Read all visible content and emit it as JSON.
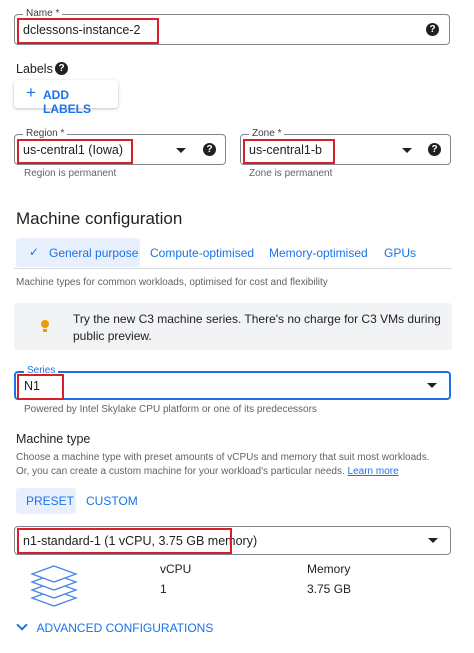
{
  "name_field": {
    "label": "Name *",
    "value": "dclessons-instance-2"
  },
  "labels": {
    "title": "Labels",
    "add_button": "ADD LABELS"
  },
  "region": {
    "label": "Region *",
    "value": "us-central1 (Iowa)",
    "hint": "Region is permanent"
  },
  "zone": {
    "label": "Zone *",
    "value": "us-central1-b",
    "hint": "Zone is permanent"
  },
  "machine_config": {
    "title": "Machine configuration",
    "tabs": [
      "General purpose",
      "Compute-optimised",
      "Memory-optimised",
      "GPUs"
    ],
    "tab_description": "Machine types for common workloads, optimised for cost and flexibility"
  },
  "notice": {
    "text_line1": "Try the new C3 machine series. There's no charge for C3 VMs during",
    "text_line2": "public preview."
  },
  "series": {
    "label": "Series",
    "value": "N1",
    "hint": "Powered by Intel Skylake CPU platform or one of its predecessors"
  },
  "machine_type": {
    "title": "Machine type",
    "desc_line1": "Choose a machine type with preset amounts of vCPUs and memory that suit most workloads.",
    "desc_line2": "Or, you can create a custom machine for your workload's particular needs.",
    "learn_more": "Learn more",
    "preset": "PRESET",
    "custom": "CUSTOM",
    "value": "n1-standard-1 (1 vCPU, 3.75 GB memory)"
  },
  "specs": {
    "vcpu_label": "vCPU",
    "vcpu_value": "1",
    "memory_label": "Memory",
    "memory_value": "3.75 GB"
  },
  "advanced": {
    "label": "ADVANCED CONFIGURATIONS"
  },
  "colors": {
    "accent": "#1a73e8",
    "highlight": "#d8202a"
  }
}
